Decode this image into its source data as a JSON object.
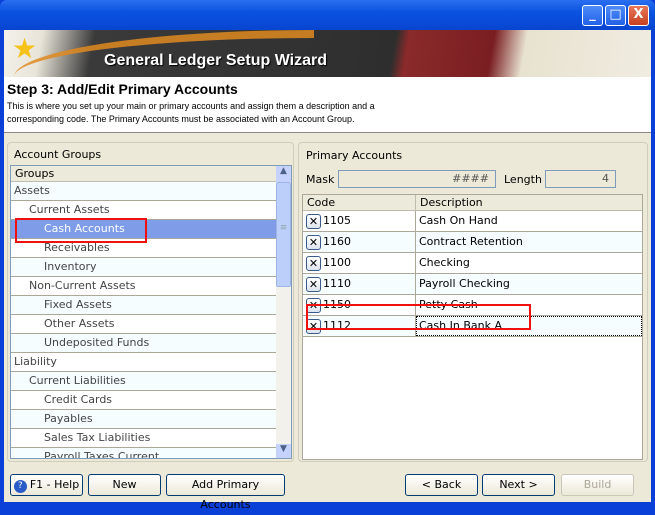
{
  "window": {
    "minimize": "_",
    "maximize": "□",
    "close": "X"
  },
  "banner": {
    "title": "General Ledger Setup Wizard"
  },
  "step": {
    "title": "Step 3: Add/Edit Primary Accounts",
    "description": "This is where you set up your main or primary accounts and assign them a description and a corresponding code. The Primary Accounts must be associated with an Account Group."
  },
  "groups": {
    "panel_title": "Account Groups",
    "column": "Groups",
    "selected": "Cash Accounts",
    "items": [
      {
        "label": "Assets",
        "level": 0
      },
      {
        "label": "Current Assets",
        "level": 1
      },
      {
        "label": "Cash Accounts",
        "level": 2
      },
      {
        "label": "Receivables",
        "level": 2
      },
      {
        "label": "Inventory",
        "level": 2
      },
      {
        "label": "Non-Current Assets",
        "level": 1
      },
      {
        "label": "Fixed Assets",
        "level": 2
      },
      {
        "label": "Other Assets",
        "level": 2
      },
      {
        "label": "Undeposited Funds",
        "level": 2
      },
      {
        "label": "Liability",
        "level": 0
      },
      {
        "label": "Current Liabilities",
        "level": 1
      },
      {
        "label": "Credit Cards",
        "level": 2
      },
      {
        "label": "Payables",
        "level": 2
      },
      {
        "label": "Sales Tax Liabilities",
        "level": 2
      },
      {
        "label": "Payroll Taxes Current",
        "level": 2
      }
    ]
  },
  "accounts": {
    "panel_title": "Primary Accounts",
    "mask_label": "Mask",
    "mask_value": "####",
    "length_label": "Length",
    "length_value": "4",
    "columns": {
      "code": "Code",
      "description": "Description"
    },
    "rows": [
      {
        "code": "1105",
        "description": "Cash On Hand"
      },
      {
        "code": "1160",
        "description": "Contract Retention"
      },
      {
        "code": "1100",
        "description": "Checking"
      },
      {
        "code": "1110",
        "description": "Payroll Checking"
      },
      {
        "code": "1150",
        "description": "Petty Cash"
      },
      {
        "code": "1112",
        "description": "Cash In Bank A"
      }
    ]
  },
  "buttons": {
    "help": "F1 - Help",
    "new": "New",
    "add_primary": "Add Primary Accounts",
    "back": "< Back",
    "next": "Next >",
    "build": "Build"
  }
}
